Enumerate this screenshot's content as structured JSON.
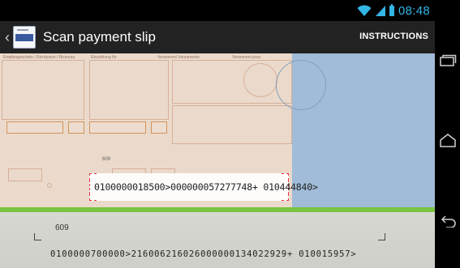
{
  "status_bar": {
    "time": "08:48",
    "accent_color": "#33b5e5",
    "icons": [
      "wifi-icon",
      "signal-icon",
      "battery-icon"
    ]
  },
  "action_bar": {
    "title": "Scan payment slip",
    "action_label": "INSTRUCTIONS",
    "app_icon": "payment-slip-app-icon"
  },
  "camera": {
    "slip_header_labels": [
      "Empfangsschein / Récépissé / Ricevuta",
      "Einzahlung für",
      "Versement Versamento",
      "Versement pour"
    ],
    "scan_frame_label": "609",
    "scanned_code": "0100000018500>000000057277748+ 010444840>",
    "bottom_number": "609",
    "bottom_code": "0100000700000>216006216026000000134022929+ 010015957>",
    "highlight_color": "#7bc342",
    "frame_color": "#e8334a"
  },
  "nav_bar": {
    "recent_apps": "recent-apps-icon",
    "home": "home-icon",
    "back": "back-icon"
  }
}
